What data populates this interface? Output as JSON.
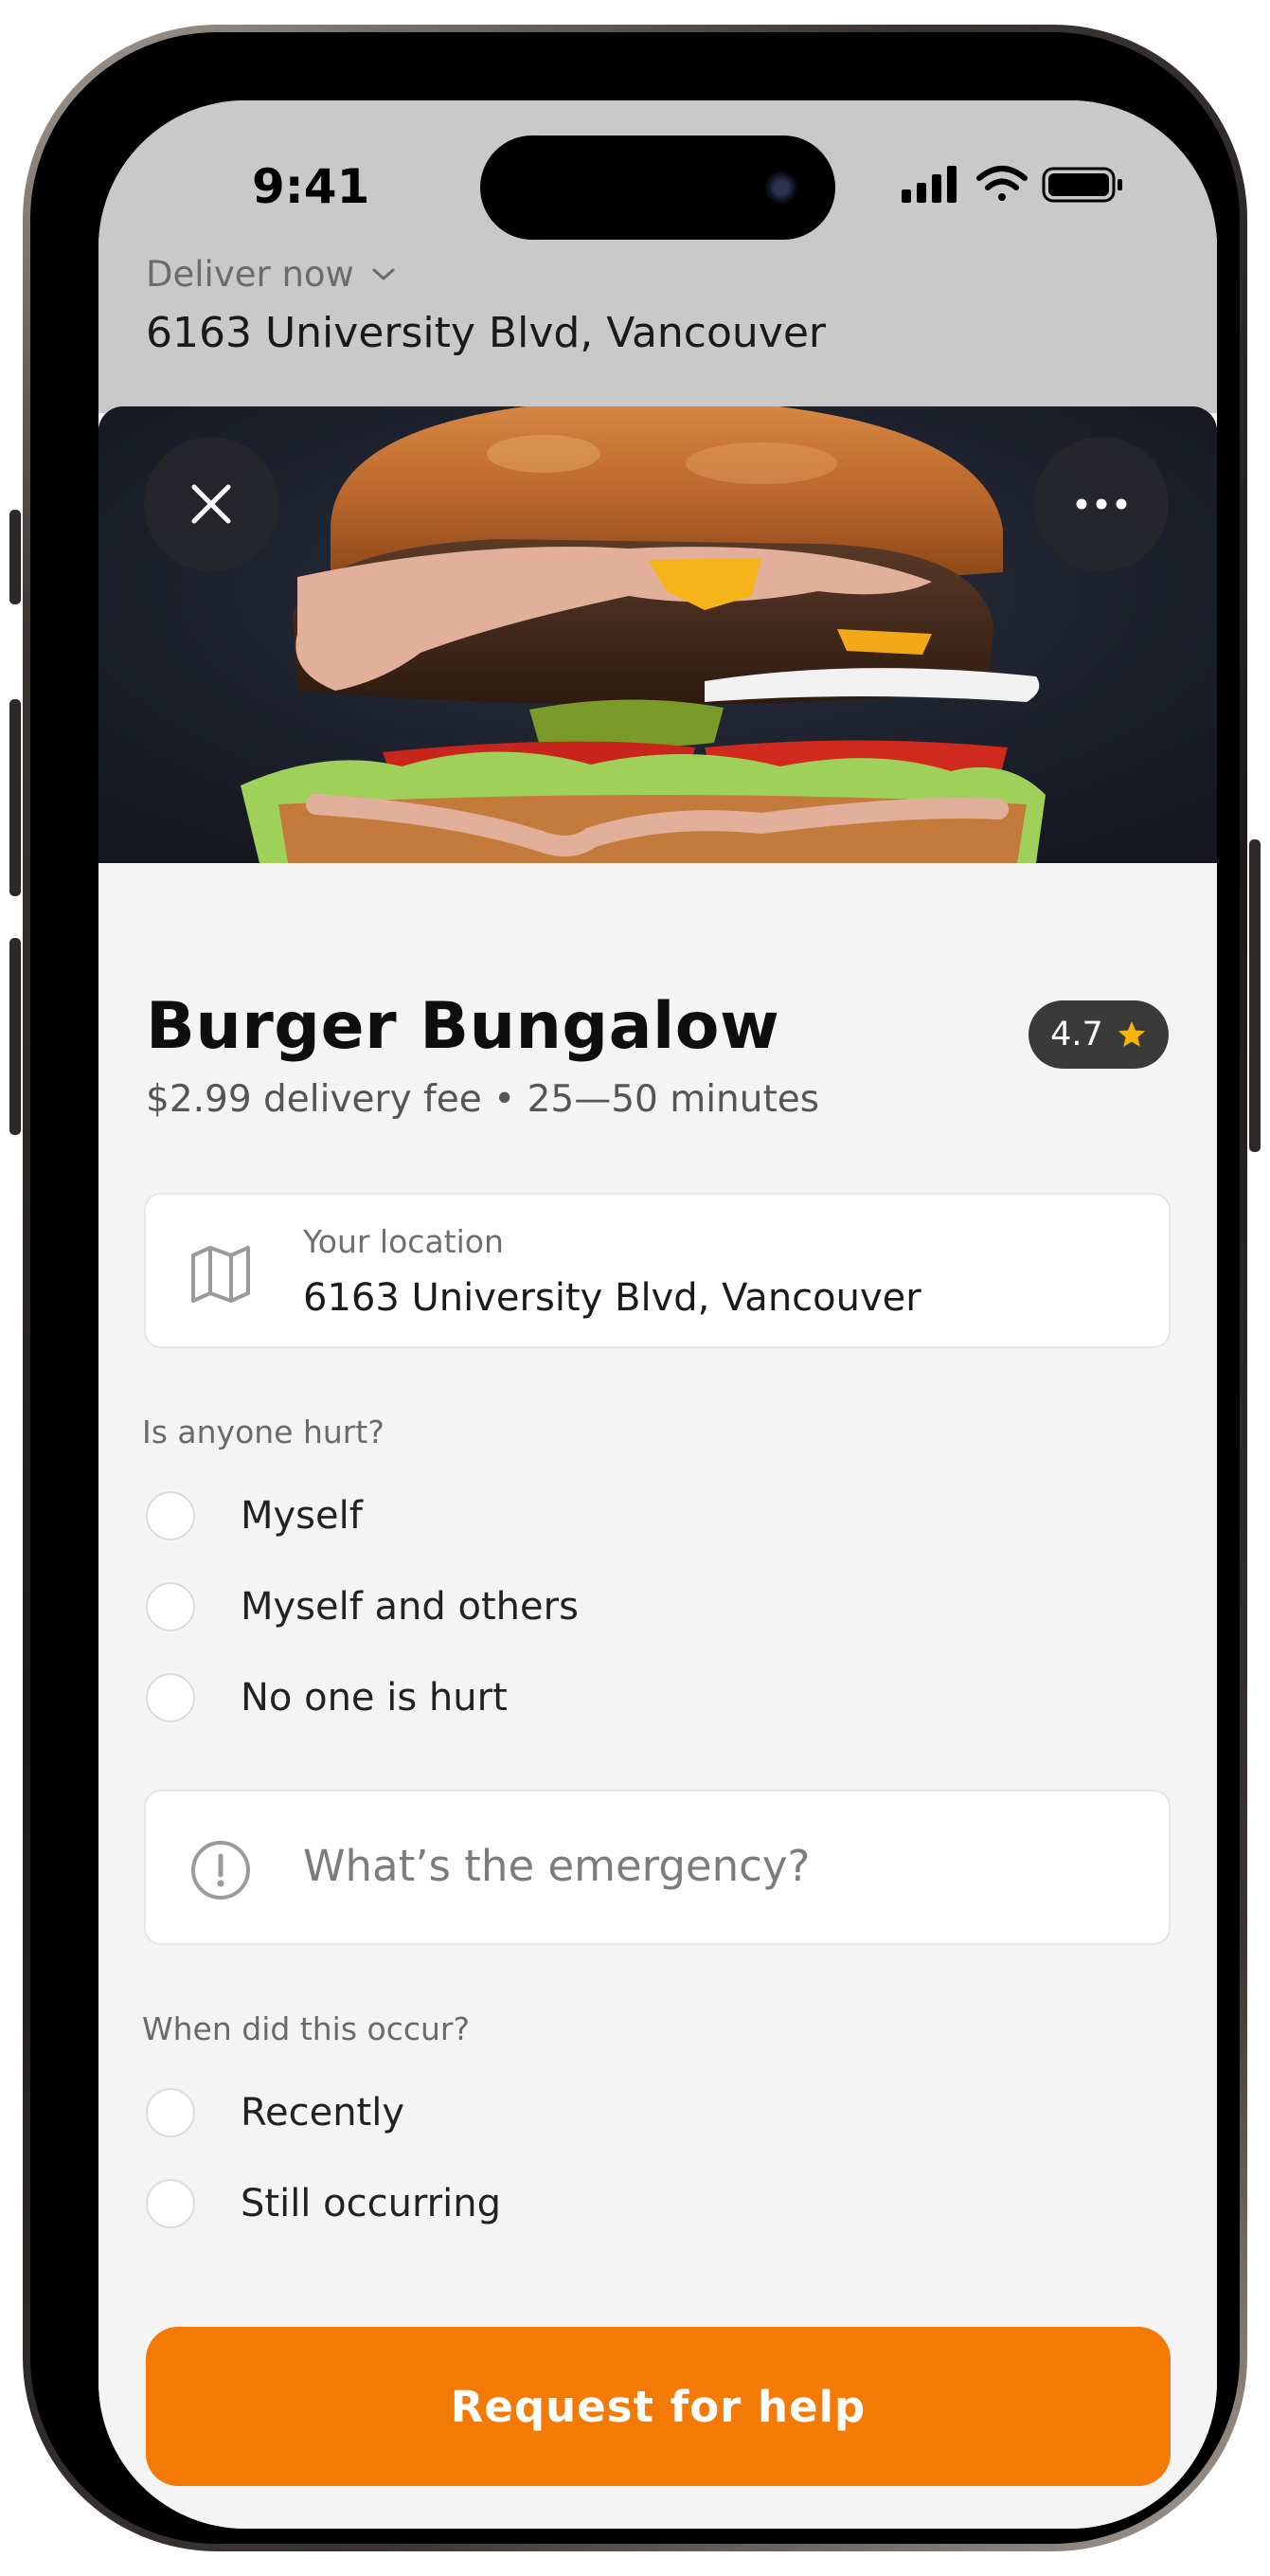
{
  "status_bar": {
    "time": "9:41",
    "icons": [
      "cellular-signal-icon",
      "wifi-icon",
      "battery-icon"
    ]
  },
  "delivery": {
    "mode_label": "Deliver now",
    "address": "6163 University Blvd, Vancouver"
  },
  "hero": {
    "image": "burger-photo",
    "close_icon": "close-icon",
    "more_icon": "more-icon"
  },
  "restaurant": {
    "name": "Burger Bungalow",
    "rating": "4.7",
    "details": "$2.99 delivery fee • 25—50 minutes"
  },
  "location_card": {
    "label": "Your location",
    "value": "6163 University Blvd, Vancouver",
    "icon": "map-icon"
  },
  "hurt_question": {
    "label": "Is anyone hurt?",
    "options": [
      "Myself",
      "Myself and others",
      "No one is hurt"
    ]
  },
  "emergency_input": {
    "placeholder": "What’s the emergency?",
    "icon": "alert-icon"
  },
  "when_question": {
    "label": "When did this occur?",
    "options": [
      "Recently",
      "Still occurring"
    ]
  },
  "cta": {
    "label": "Request for help"
  },
  "colors": {
    "accent": "#f37a06",
    "star": "#f6b40c",
    "rating_pill": "#3a3a3a"
  }
}
